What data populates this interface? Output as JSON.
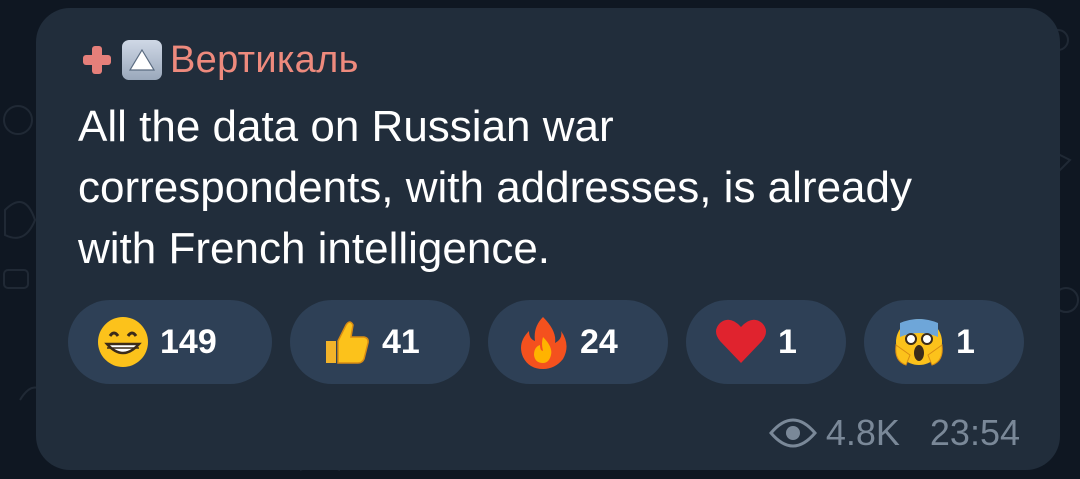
{
  "channel": {
    "name": "Вертикаль"
  },
  "message": {
    "text": "All the data on Russian war correspondents, with addresses, is already with French intelligence."
  },
  "reactions": [
    {
      "emoji": "grinning-face",
      "count": "149"
    },
    {
      "emoji": "thumbs-up",
      "count": "41"
    },
    {
      "emoji": "fire",
      "count": "24"
    },
    {
      "emoji": "red-heart",
      "count": "1"
    },
    {
      "emoji": "screaming-face",
      "count": "1"
    }
  ],
  "meta": {
    "views": "4.8K",
    "time": "23:54"
  },
  "colors": {
    "bubble": "#212d3b",
    "channel_name": "#ee8a7d",
    "reaction_bg": "#2e4056",
    "meta_text": "#7a8898"
  }
}
